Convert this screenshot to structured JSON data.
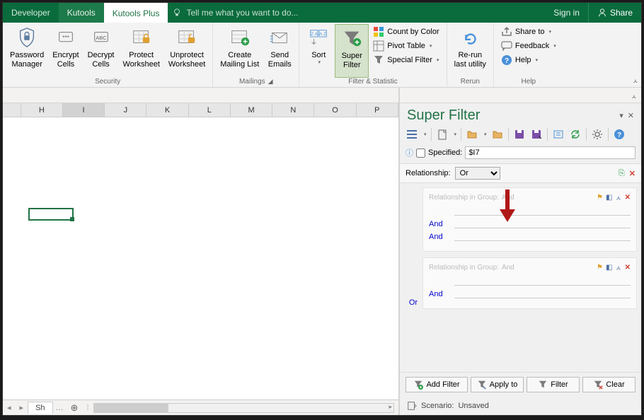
{
  "tabs": {
    "developer": "Developer",
    "kutools": "Kutools",
    "kutools_plus": "Kutools Plus"
  },
  "tellme": "Tell me what you want to do...",
  "signin": "Sign in",
  "share": "Share",
  "ribbon": {
    "security": {
      "password_manager": "Password\nManager",
      "encrypt_cells": "Encrypt\nCells",
      "decrypt_cells": "Decrypt\nCells",
      "protect_ws": "Protect\nWorksheet",
      "unprotect_ws": "Unprotect\nWorksheet",
      "label": "Security"
    },
    "mailings": {
      "create_ml": "Create\nMailing List",
      "send_emails": "Send\nEmails",
      "label": "Mailings"
    },
    "filter": {
      "sort": "Sort",
      "super_filter": "Super\nFilter",
      "count_by_color": "Count by Color",
      "pivot_table": "Pivot Table",
      "special_filter": "Special Filter",
      "label": "Filter & Statistic"
    },
    "rerun": {
      "rerun": "Re-run\nlast utility",
      "label": "Rerun"
    },
    "help": {
      "share_to": "Share to",
      "feedback": "Feedback",
      "help": "Help",
      "label": "Help"
    }
  },
  "columns": [
    "H",
    "I",
    "J",
    "K",
    "L",
    "M",
    "N",
    "O",
    "P"
  ],
  "sheet_tab": "Sheet1_short",
  "sheet_tab_display": "Sh",
  "pane": {
    "title": "Super Filter",
    "specified": "Specified:",
    "specified_value": "$I7",
    "relationship": "Relationship:",
    "relationship_value": "Or",
    "group": {
      "label": "Relationship in Group:",
      "value": "And",
      "and": "And",
      "or": "Or"
    },
    "actions": {
      "add_filter": "Add Filter",
      "apply_to": "Apply to",
      "filter": "Filter",
      "clear": "Clear"
    },
    "scenario_label": "Scenario:",
    "scenario_value": "Unsaved"
  }
}
